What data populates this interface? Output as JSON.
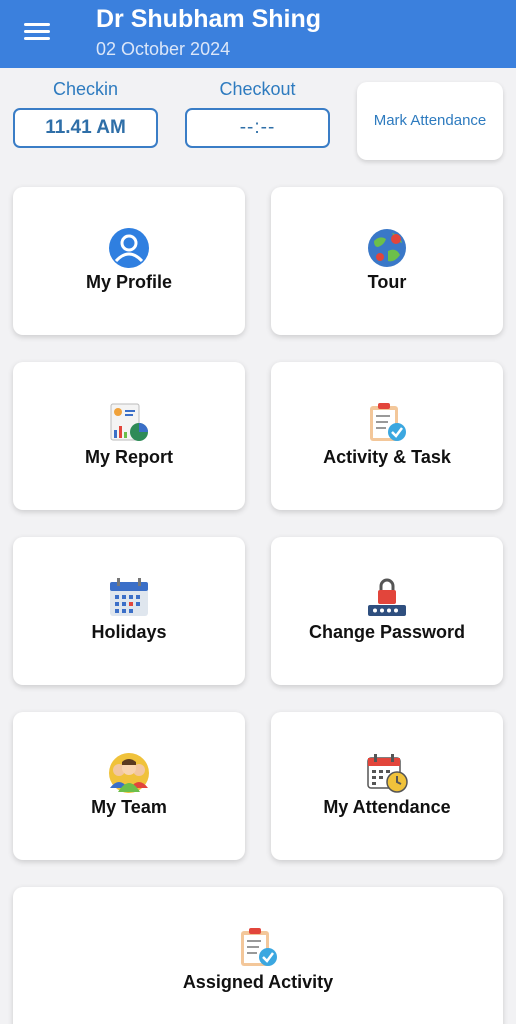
{
  "header": {
    "user_name": "Dr Shubham Shing",
    "date": "02 October 2024",
    "menu_icon": "hamburger-menu-icon"
  },
  "attendance": {
    "checkin_label": "Checkin",
    "checkin_value": "11.41 AM",
    "checkout_label": "Checkout",
    "checkout_value": "--:--",
    "mark_label": "Mark Attendance"
  },
  "menu": [
    {
      "label": "My Profile",
      "icon": "profile-icon"
    },
    {
      "label": "Tour",
      "icon": "globe-icon"
    },
    {
      "label": "My Report",
      "icon": "report-icon"
    },
    {
      "label": "Activity & Task",
      "icon": "clipboard-check-icon"
    },
    {
      "label": "Holidays",
      "icon": "calendar-icon"
    },
    {
      "label": "Change Password",
      "icon": "lock-password-icon"
    },
    {
      "label": "My Team",
      "icon": "team-icon"
    },
    {
      "label": "My Attendance",
      "icon": "attendance-calendar-icon"
    },
    {
      "label": "Assigned Activity",
      "icon": "clipboard-check-icon"
    }
  ],
  "colors": {
    "header": "#3b80dd",
    "accent": "#2e7bbf",
    "background": "#f2f2f4"
  }
}
